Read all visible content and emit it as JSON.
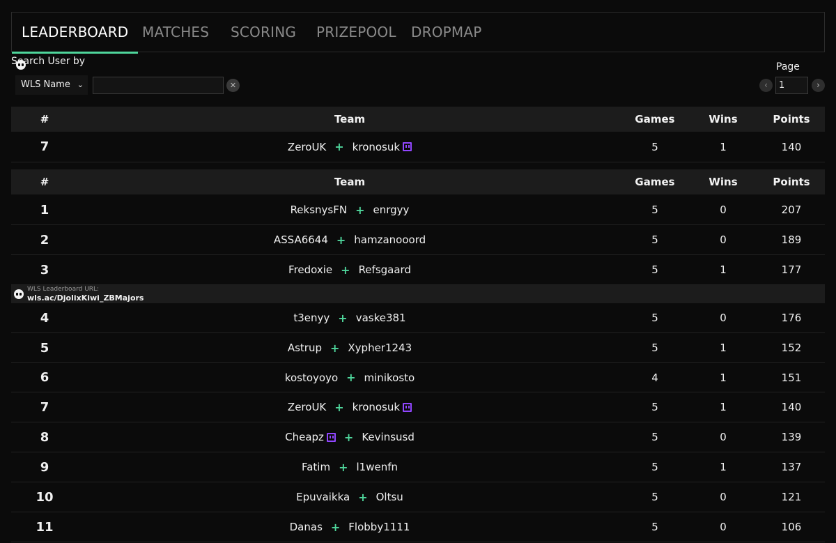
{
  "tabs": [
    {
      "label": "LEADERBOARD",
      "active": true
    },
    {
      "label": "MATCHES",
      "active": false
    },
    {
      "label": "SCORING",
      "active": false
    },
    {
      "label": "PRIZEPOOL",
      "active": false
    },
    {
      "label": "DROPMAP",
      "active": false
    }
  ],
  "search": {
    "label": "Search User by",
    "mode": "WLS Name",
    "value": "",
    "placeholder": ""
  },
  "pagination": {
    "label": "Page",
    "current": "1"
  },
  "table": {
    "headers": {
      "rank": "#",
      "team": "Team",
      "games": "Games",
      "wins": "Wins",
      "points": "Points"
    },
    "highlight": [
      {
        "rank": "7",
        "team": [
          "ZeroUK",
          "kronosuk"
        ],
        "twitch": [
          false,
          true
        ],
        "games": "5",
        "wins": "1",
        "points": "140"
      }
    ],
    "rows": [
      {
        "rank": "1",
        "team": [
          "ReksnysFN",
          "enrgyy"
        ],
        "twitch": [
          false,
          false
        ],
        "games": "5",
        "wins": "0",
        "points": "207"
      },
      {
        "rank": "2",
        "team": [
          "ASSA6644",
          "hamzanooord"
        ],
        "twitch": [
          false,
          false
        ],
        "games": "5",
        "wins": "0",
        "points": "189"
      },
      {
        "rank": "3",
        "team": [
          "Fredoxie",
          "Refsgaard"
        ],
        "twitch": [
          false,
          false
        ],
        "games": "5",
        "wins": "1",
        "points": "177"
      },
      {
        "rank": "4",
        "team": [
          "t3enyy",
          "vaske381"
        ],
        "twitch": [
          false,
          false
        ],
        "games": "5",
        "wins": "0",
        "points": "176"
      },
      {
        "rank": "5",
        "team": [
          "Astrup",
          "Xypher1243"
        ],
        "twitch": [
          false,
          false
        ],
        "games": "5",
        "wins": "1",
        "points": "152"
      },
      {
        "rank": "6",
        "team": [
          "kostoyoyo",
          "minikosto"
        ],
        "twitch": [
          false,
          false
        ],
        "games": "4",
        "wins": "1",
        "points": "151"
      },
      {
        "rank": "7",
        "team": [
          "ZeroUK",
          "kronosuk"
        ],
        "twitch": [
          false,
          true
        ],
        "games": "5",
        "wins": "1",
        "points": "140"
      },
      {
        "rank": "8",
        "team": [
          "Cheapz",
          "Kevinsusd"
        ],
        "twitch": [
          true,
          false
        ],
        "games": "5",
        "wins": "0",
        "points": "139"
      },
      {
        "rank": "9",
        "team": [
          "Fatim",
          "l1wenfn"
        ],
        "twitch": [
          false,
          false
        ],
        "games": "5",
        "wins": "1",
        "points": "137"
      },
      {
        "rank": "10",
        "team": [
          "Epuvaikka",
          "Oltsu"
        ],
        "twitch": [
          false,
          false
        ],
        "games": "5",
        "wins": "0",
        "points": "121"
      },
      {
        "rank": "11",
        "team": [
          "Danas",
          "Flobby1111"
        ],
        "twitch": [
          false,
          false
        ],
        "games": "5",
        "wins": "0",
        "points": "106"
      }
    ]
  },
  "banner": {
    "caption": "WLS Leaderboard URL:",
    "url": "wls.ac/DjolixKiwi_ZBMajors"
  },
  "icons": {
    "team_separator": "plus-icon",
    "streamer_badge": "twitch-icon",
    "brand": "wls-logo-icon"
  },
  "colors": {
    "accent": "#4fd69c",
    "twitch": "#9146ff",
    "background": "#0b0b0b",
    "header_bg": "#1c1c1c"
  }
}
